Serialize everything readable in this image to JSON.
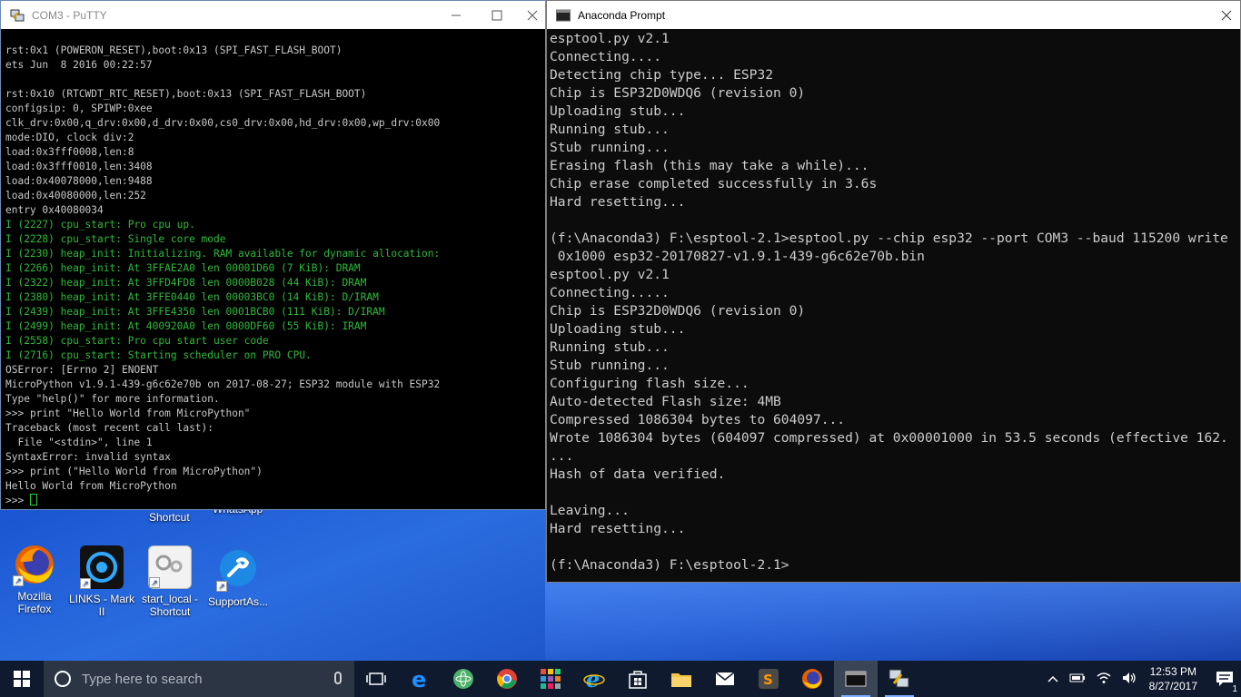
{
  "putty": {
    "title": "COM3 - PuTTY",
    "lines": [
      {
        "text": "rst:0x1 (POWERON_RESET),boot:0x13 (SPI_FAST_FLASH_BOOT)",
        "color": "#c8c8c8"
      },
      {
        "text": "ets Jun  8 2016 00:22:57",
        "color": "#c8c8c8"
      },
      {
        "text": "",
        "color": "#c8c8c8"
      },
      {
        "text": "rst:0x10 (RTCWDT_RTC_RESET),boot:0x13 (SPI_FAST_FLASH_BOOT)",
        "color": "#c8c8c8"
      },
      {
        "text": "configsip: 0, SPIWP:0xee",
        "color": "#c8c8c8"
      },
      {
        "text": "clk_drv:0x00,q_drv:0x00,d_drv:0x00,cs0_drv:0x00,hd_drv:0x00,wp_drv:0x00",
        "color": "#c8c8c8"
      },
      {
        "text": "mode:DIO, clock div:2",
        "color": "#c8c8c8"
      },
      {
        "text": "load:0x3fff0008,len:8",
        "color": "#c8c8c8"
      },
      {
        "text": "load:0x3fff0010,len:3408",
        "color": "#c8c8c8"
      },
      {
        "text": "load:0x40078000,len:9488",
        "color": "#c8c8c8"
      },
      {
        "text": "load:0x40080000,len:252",
        "color": "#c8c8c8"
      },
      {
        "text": "entry 0x40080034",
        "color": "#c8c8c8"
      },
      {
        "text": "I (2227) cpu_start: Pro cpu up.",
        "color": "#2fb93a"
      },
      {
        "text": "I (2228) cpu_start: Single core mode",
        "color": "#2fb93a"
      },
      {
        "text": "I (2230) heap_init: Initializing. RAM available for dynamic allocation:",
        "color": "#2fb93a"
      },
      {
        "text": "I (2266) heap_init: At 3FFAE2A0 len 00001D60 (7 KiB): DRAM",
        "color": "#2fb93a"
      },
      {
        "text": "I (2322) heap_init: At 3FFD4FD8 len 0000B028 (44 KiB): DRAM",
        "color": "#2fb93a"
      },
      {
        "text": "I (2380) heap_init: At 3FFE0440 len 00003BC0 (14 KiB): D/IRAM",
        "color": "#2fb93a"
      },
      {
        "text": "I (2439) heap_init: At 3FFE4350 len 0001BCB0 (111 KiB): D/IRAM",
        "color": "#2fb93a"
      },
      {
        "text": "I (2499) heap_init: At 400920A0 len 0000DF60 (55 KiB): IRAM",
        "color": "#2fb93a"
      },
      {
        "text": "I (2558) cpu_start: Pro cpu start user code",
        "color": "#2fb93a"
      },
      {
        "text": "I (2716) cpu_start: Starting scheduler on PRO CPU.",
        "color": "#2fb93a"
      },
      {
        "text": "OSError: [Errno 2] ENOENT",
        "color": "#c8c8c8"
      },
      {
        "text": "MicroPython v1.9.1-439-g6c62e70b on 2017-08-27; ESP32 module with ESP32",
        "color": "#c8c8c8"
      },
      {
        "text": "Type \"help()\" for more information.",
        "color": "#c8c8c8"
      },
      {
        "text": ">>> print \"Hello World from MicroPython\"",
        "color": "#c8c8c8"
      },
      {
        "text": "Traceback (most recent call last):",
        "color": "#c8c8c8"
      },
      {
        "text": "  File \"<stdin>\", line 1",
        "color": "#c8c8c8"
      },
      {
        "text": "SyntaxError: invalid syntax",
        "color": "#c8c8c8"
      },
      {
        "text": ">>> print (\"Hello World from MicroPython\")",
        "color": "#c8c8c8"
      },
      {
        "text": "Hello World from MicroPython",
        "color": "#c8c8c8"
      }
    ],
    "prompt": ">>> "
  },
  "conda": {
    "title": "Anaconda Prompt",
    "lines": [
      "esptool.py v2.1",
      "Connecting....",
      "Detecting chip type... ESP32",
      "Chip is ESP32D0WDQ6 (revision 0)",
      "Uploading stub...",
      "Running stub...",
      "Stub running...",
      "Erasing flash (this may take a while)...",
      "Chip erase completed successfully in 3.6s",
      "Hard resetting...",
      "",
      "(f:\\Anaconda3) F:\\esptool-2.1>esptool.py --chip esp32 --port COM3 --baud 115200 write",
      " 0x1000 esp32-20170827-v1.9.1-439-g6c62e70b.bin",
      "esptool.py v2.1",
      "Connecting.....",
      "Chip is ESP32D0WDQ6 (revision 0)",
      "Uploading stub...",
      "Running stub...",
      "Stub running...",
      "Configuring flash size...",
      "Auto-detected Flash size: 4MB",
      "Compressed 1086304 bytes to 604097...",
      "Wrote 1086304 bytes (604097 compressed) at 0x00001000 in 53.5 seconds (effective 162.",
      "...",
      "Hash of data verified.",
      "",
      "Leaving...",
      "Hard resetting...",
      "",
      "(f:\\Anaconda3) F:\\esptool-2.1>"
    ]
  },
  "desktop": {
    "partial_labels": [
      "Shortcut",
      "WhatsApp"
    ],
    "icons": [
      {
        "label": "Mozilla Firefox",
        "icon": "firefox-icon"
      },
      {
        "label": "LINKS - Mark II",
        "icon": "links-icon"
      },
      {
        "label": "start_local - Shortcut",
        "icon": "shortcut-icon"
      },
      {
        "label": "SupportAs...",
        "icon": "support-assist-icon"
      }
    ]
  },
  "taskbar": {
    "search_placeholder": "Type here to search",
    "time": "12:53 PM",
    "date": "8/27/2017",
    "notification_count": "1"
  },
  "colors": {
    "putty_green": "#2fb93a",
    "terminal_bg": "#0c0c0c",
    "taskbar_bg": "#0f1a2e"
  }
}
